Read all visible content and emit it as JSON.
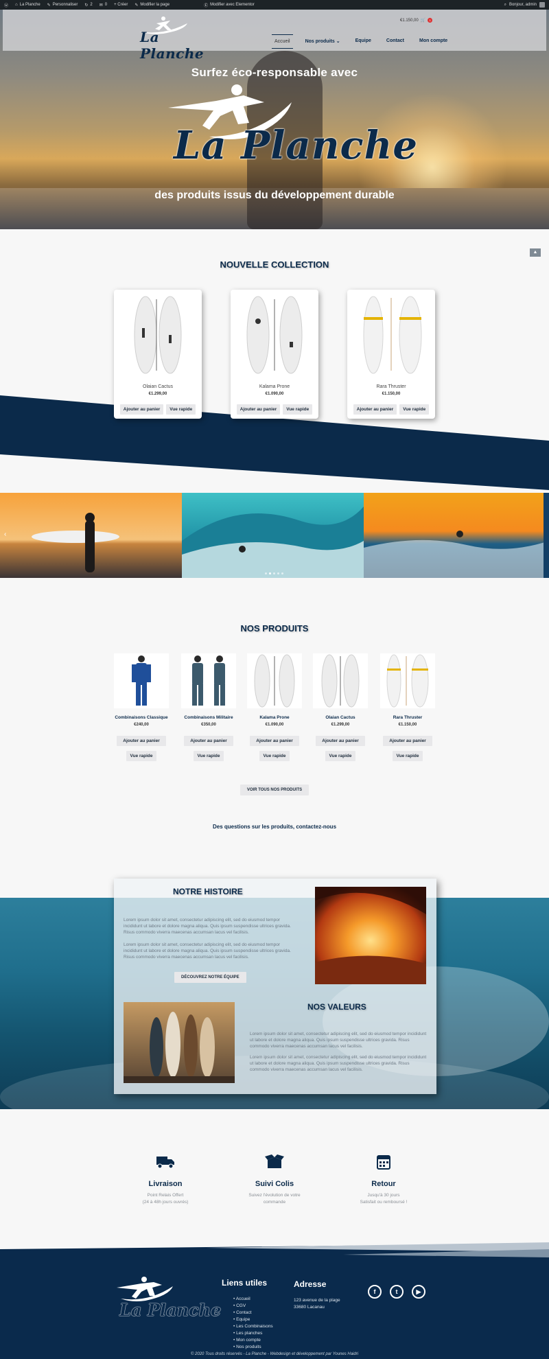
{
  "adminbar": {
    "site": "La Planche",
    "customize": "Personnaliser",
    "updates": "2",
    "comments": "0",
    "new": "+ Créer",
    "edit_page": "Modifier la page",
    "elementor": "Modifier avec Elementor",
    "greeting": "Bonjour, admin"
  },
  "header": {
    "logo_text": "La Planche",
    "cart_total": "€1.150,00",
    "cart_count": "1",
    "nav": [
      "Accueil",
      "Nos produits",
      "Equipe",
      "Contact",
      "Mon compte"
    ]
  },
  "hero": {
    "title": "Surfez éco-responsable avec",
    "logo_text": "La Planche",
    "subtitle": "des produits issus du développement durable"
  },
  "collection": {
    "title": "NOUVELLE COLLECTION",
    "items": [
      {
        "name": "Olaian Cactus",
        "price": "€1.299,00"
      },
      {
        "name": "Kalama Prone",
        "price": "€1.090,00"
      },
      {
        "name": "Rara Thruster",
        "price": "€1.150,00"
      }
    ],
    "add_label": "Ajouter au panier",
    "quick_label": "Vue rapide"
  },
  "carousel": {
    "arrow": "‹"
  },
  "products": {
    "title": "NOS PRODUITS",
    "items": [
      {
        "name": "Combinaisons Classique",
        "price": "€240,00"
      },
      {
        "name": "Combinaisons Militaire",
        "price": "€350,00"
      },
      {
        "name": "Kalama Prone",
        "price": "€1.090,00"
      },
      {
        "name": "Olaian Cactus",
        "price": "€1.299,00"
      },
      {
        "name": "Rara Thruster",
        "price": "€1.150,00"
      }
    ],
    "add_label": "Ajouter au panier",
    "quick_label": "Vue rapide",
    "see_all": "VOIR TOUS NOS PRODUITS",
    "questions": "Des questions sur les produits, contactez-nous"
  },
  "story": {
    "histoire_title": "NOTRE HISTOIRE",
    "histoire_p1": "Lorem ipsum dolor sit amet, consectetur adipiscing elit, sed do eiusmod tempor incididunt ut labore et dolore magna aliqua. Quis ipsum suspendisse ultrices gravida. Risus commodo viverra maecenas accumsan lacus vel facilisis.",
    "histoire_p2": "Lorem ipsum dolor sit amet, consectetur adipiscing elit, sed do eiusmod tempor incididunt ut labore et dolore magna aliqua. Quis ipsum suspendisse ultrices gravida. Risus commodo viverra maecenas accumsan lacus vel facilisis.",
    "button": "DÉCOUVREZ NOTRE ÉQUIPE",
    "valeurs_title": "NOS VALEURS",
    "valeurs_p1": "Lorem ipsum dolor sit amet, consectetur adipiscing elit, sed do eiusmod tempor incididunt ut labore et dolore magna aliqua. Quis ipsum suspendisse ultrices gravida. Risus commodo viverra maecenas accumsan lacus vel facilisis.",
    "valeurs_p2": "Lorem ipsum dolor sit amet, consectetur adipiscing elit, sed do eiusmod tempor incididunt ut labore et dolore magna aliqua. Quis ipsum suspendisse ultrices gravida. Risus commodo viverra maecenas accumsan lacus vel facilisis."
  },
  "features": [
    {
      "title": "Livraison",
      "line1": "Point Relais Offert",
      "line2": "(24 à 48h jours ouvrés)"
    },
    {
      "title": "Suivi Colis",
      "line1": "Suivez l'évolution de votre",
      "line2": "commande"
    },
    {
      "title": "Retour",
      "line1": "Jusqu'à 30 jours",
      "line2": "Satisfait ou remboursé !"
    }
  ],
  "footer": {
    "logo_text": "La Planche",
    "links_title": "Liens utiles",
    "links": [
      "Accueil",
      "CGV",
      "Contact",
      "Equipe",
      "Les Combinaisons",
      "Les planches",
      "Mon compte",
      "Nos produits"
    ],
    "address_title": "Adresse",
    "address_line1": "123 avenue de la plage",
    "address_line2": "33680 Lacanau",
    "social": [
      "f",
      "t",
      "▶"
    ],
    "copyright": "© 2020 Tous droits réservés - La Planche - Webdesign et développement par Younes Haidri"
  },
  "colors": {
    "navy": "#0b2a4a",
    "footer": "#0a2a4c",
    "ocean": "#1f6e8c"
  }
}
